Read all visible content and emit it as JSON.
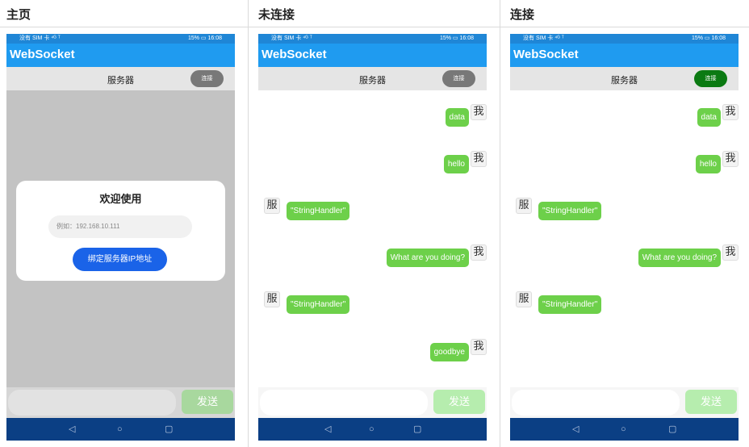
{
  "columns": [
    {
      "title": "主页",
      "status_left": "没有 SIM 卡 ⁴ᴳ ᵀ",
      "status_right": "15% ▭ 16:08",
      "app_title": "WebSocket",
      "server_label": "服务器",
      "connect_label": "连接",
      "dialog": {
        "title": "欢迎使用",
        "placeholder": "例如：192.168.10.111",
        "button": "绑定服务器IP地址"
      },
      "send_label": "发送",
      "nav": {
        "back": "◁",
        "home": "○",
        "recent": "▢"
      }
    },
    {
      "title": "未连接",
      "status_left": "没有 SIM 卡 ⁴ᴳ ᵀ",
      "status_right": "15% ▭ 16:08",
      "app_title": "WebSocket",
      "server_label": "服务器",
      "connect_label": "连接",
      "send_label": "发送",
      "nav": {
        "back": "◁",
        "home": "○",
        "recent": "▢"
      },
      "messages": [
        {
          "side": "right",
          "text": "data",
          "avatar": "我"
        },
        {
          "side": "right",
          "text": "hello",
          "avatar": "我"
        },
        {
          "side": "left",
          "text": "\"StringHandler\"",
          "avatar": "服"
        },
        {
          "side": "right",
          "text": "What are you doing?",
          "avatar": "我"
        },
        {
          "side": "left",
          "text": "\"StringHandler\"",
          "avatar": "服"
        },
        {
          "side": "right",
          "text": "goodbye",
          "avatar": "我"
        }
      ]
    },
    {
      "title": "连接",
      "status_left": "没有 SIM 卡 ⁴ᴳ ᵀ",
      "status_right": "15% ▭ 16:08",
      "app_title": "WebSocket",
      "server_label": "服务器",
      "connect_label": "连接",
      "send_label": "发送",
      "nav": {
        "back": "◁",
        "home": "○",
        "recent": "▢"
      },
      "messages": [
        {
          "side": "right",
          "text": "data",
          "avatar": "我"
        },
        {
          "side": "right",
          "text": "hello",
          "avatar": "我"
        },
        {
          "side": "left",
          "text": "\"StringHandler\"",
          "avatar": "服"
        },
        {
          "side": "right",
          "text": "What are you doing?",
          "avatar": "我"
        },
        {
          "side": "left",
          "text": "\"StringHandler\"",
          "avatar": "服"
        }
      ]
    }
  ],
  "colors": {
    "app_bar": "#1f9bf0",
    "bubble": "#6dd04a",
    "connect_off": "#787878",
    "connect_on": "#0b7a12",
    "dialog_button": "#1a63e8",
    "nav_bar": "#0b3f84"
  }
}
